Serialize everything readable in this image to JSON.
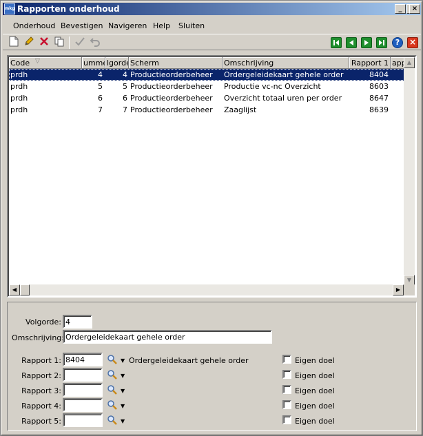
{
  "window": {
    "title": "Rapporten onderhoud",
    "app_icon_text": "mkg"
  },
  "menu": [
    "Onderhoud",
    "Bevestigen",
    "Navigeren",
    "Help",
    "Sluiten"
  ],
  "toolbar": {
    "icons": [
      "new-document-icon",
      "edit-pencil-icon",
      "delete-x-icon",
      "copy-icon",
      "confirm-check-icon",
      "undo-icon"
    ],
    "nav": [
      "first-record-icon",
      "previous-record-icon",
      "next-record-icon",
      "last-record-icon",
      "help-icon",
      "close-icon"
    ]
  },
  "grid": {
    "columns": [
      "Code",
      "ummer",
      "lgorde",
      "Scherm",
      "Omschrijving",
      "Rapport 1",
      "appo"
    ],
    "rows": [
      {
        "code": "prdh",
        "nummer": "4",
        "volgorde": "4",
        "scherm": "Productieorderbeheer",
        "omschrijving": "Ordergeleidekaart gehele order",
        "rapport1": "8404"
      },
      {
        "code": "prdh",
        "nummer": "5",
        "volgorde": "5",
        "scherm": "Productieorderbeheer",
        "omschrijving": "Productie vc-nc Overzicht",
        "rapport1": "8603"
      },
      {
        "code": "prdh",
        "nummer": "6",
        "volgorde": "6",
        "scherm": "Productieorderbeheer",
        "omschrijving": "Overzicht totaal uren per order",
        "rapport1": "8647"
      },
      {
        "code": "prdh",
        "nummer": "7",
        "volgorde": "7",
        "scherm": "Productieorderbeheer",
        "omschrijving": "Zaaglijst",
        "rapport1": "8639"
      }
    ],
    "selected_index": 0
  },
  "form": {
    "volgorde_label": "Volgorde:",
    "volgorde_value": "4",
    "omschrijving_label": "Omschrijving:",
    "omschrijving_value": "Ordergeleidekaart gehele order",
    "rapporten": [
      {
        "label": "Rapport 1:",
        "value": "8404",
        "description": "Ordergeleidekaart gehele order",
        "eigen_doel_label": "Eigen doel",
        "eigen_doel": false
      },
      {
        "label": "Rapport 2:",
        "value": "",
        "description": "",
        "eigen_doel_label": "Eigen doel",
        "eigen_doel": false
      },
      {
        "label": "Rapport 3:",
        "value": "",
        "description": "",
        "eigen_doel_label": "Eigen doel",
        "eigen_doel": false
      },
      {
        "label": "Rapport 4:",
        "value": "",
        "description": "",
        "eigen_doel_label": "Eigen doel",
        "eigen_doel": false
      },
      {
        "label": "Rapport 5:",
        "value": "",
        "description": "",
        "eigen_doel_label": "Eigen doel",
        "eigen_doel": false
      }
    ]
  },
  "colors": {
    "titlebar_start": "#0a246a",
    "titlebar_end": "#a6caf0",
    "selection": "#0a246a",
    "nav_green": "#1f8f2e",
    "help_blue": "#1f5fbf",
    "close_red": "#d9371e"
  }
}
